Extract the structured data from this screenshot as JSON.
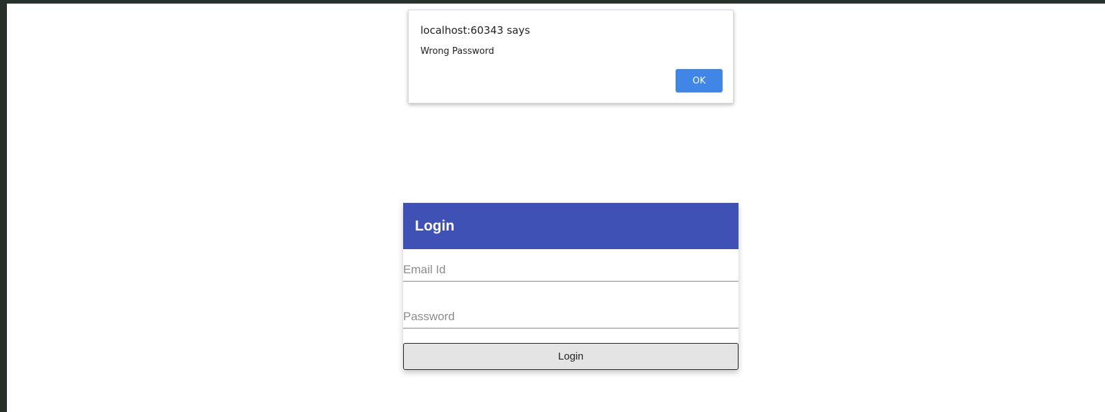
{
  "alert": {
    "title": "localhost:60343 says",
    "message": "Wrong Password",
    "ok_label": "OK",
    "button_color": "#3f86e6"
  },
  "login": {
    "header_title": "Login",
    "header_color": "#3f51b5",
    "email_placeholder": "Email Id",
    "email_value": "",
    "password_placeholder": "Password",
    "password_value": "",
    "submit_label": "Login"
  }
}
